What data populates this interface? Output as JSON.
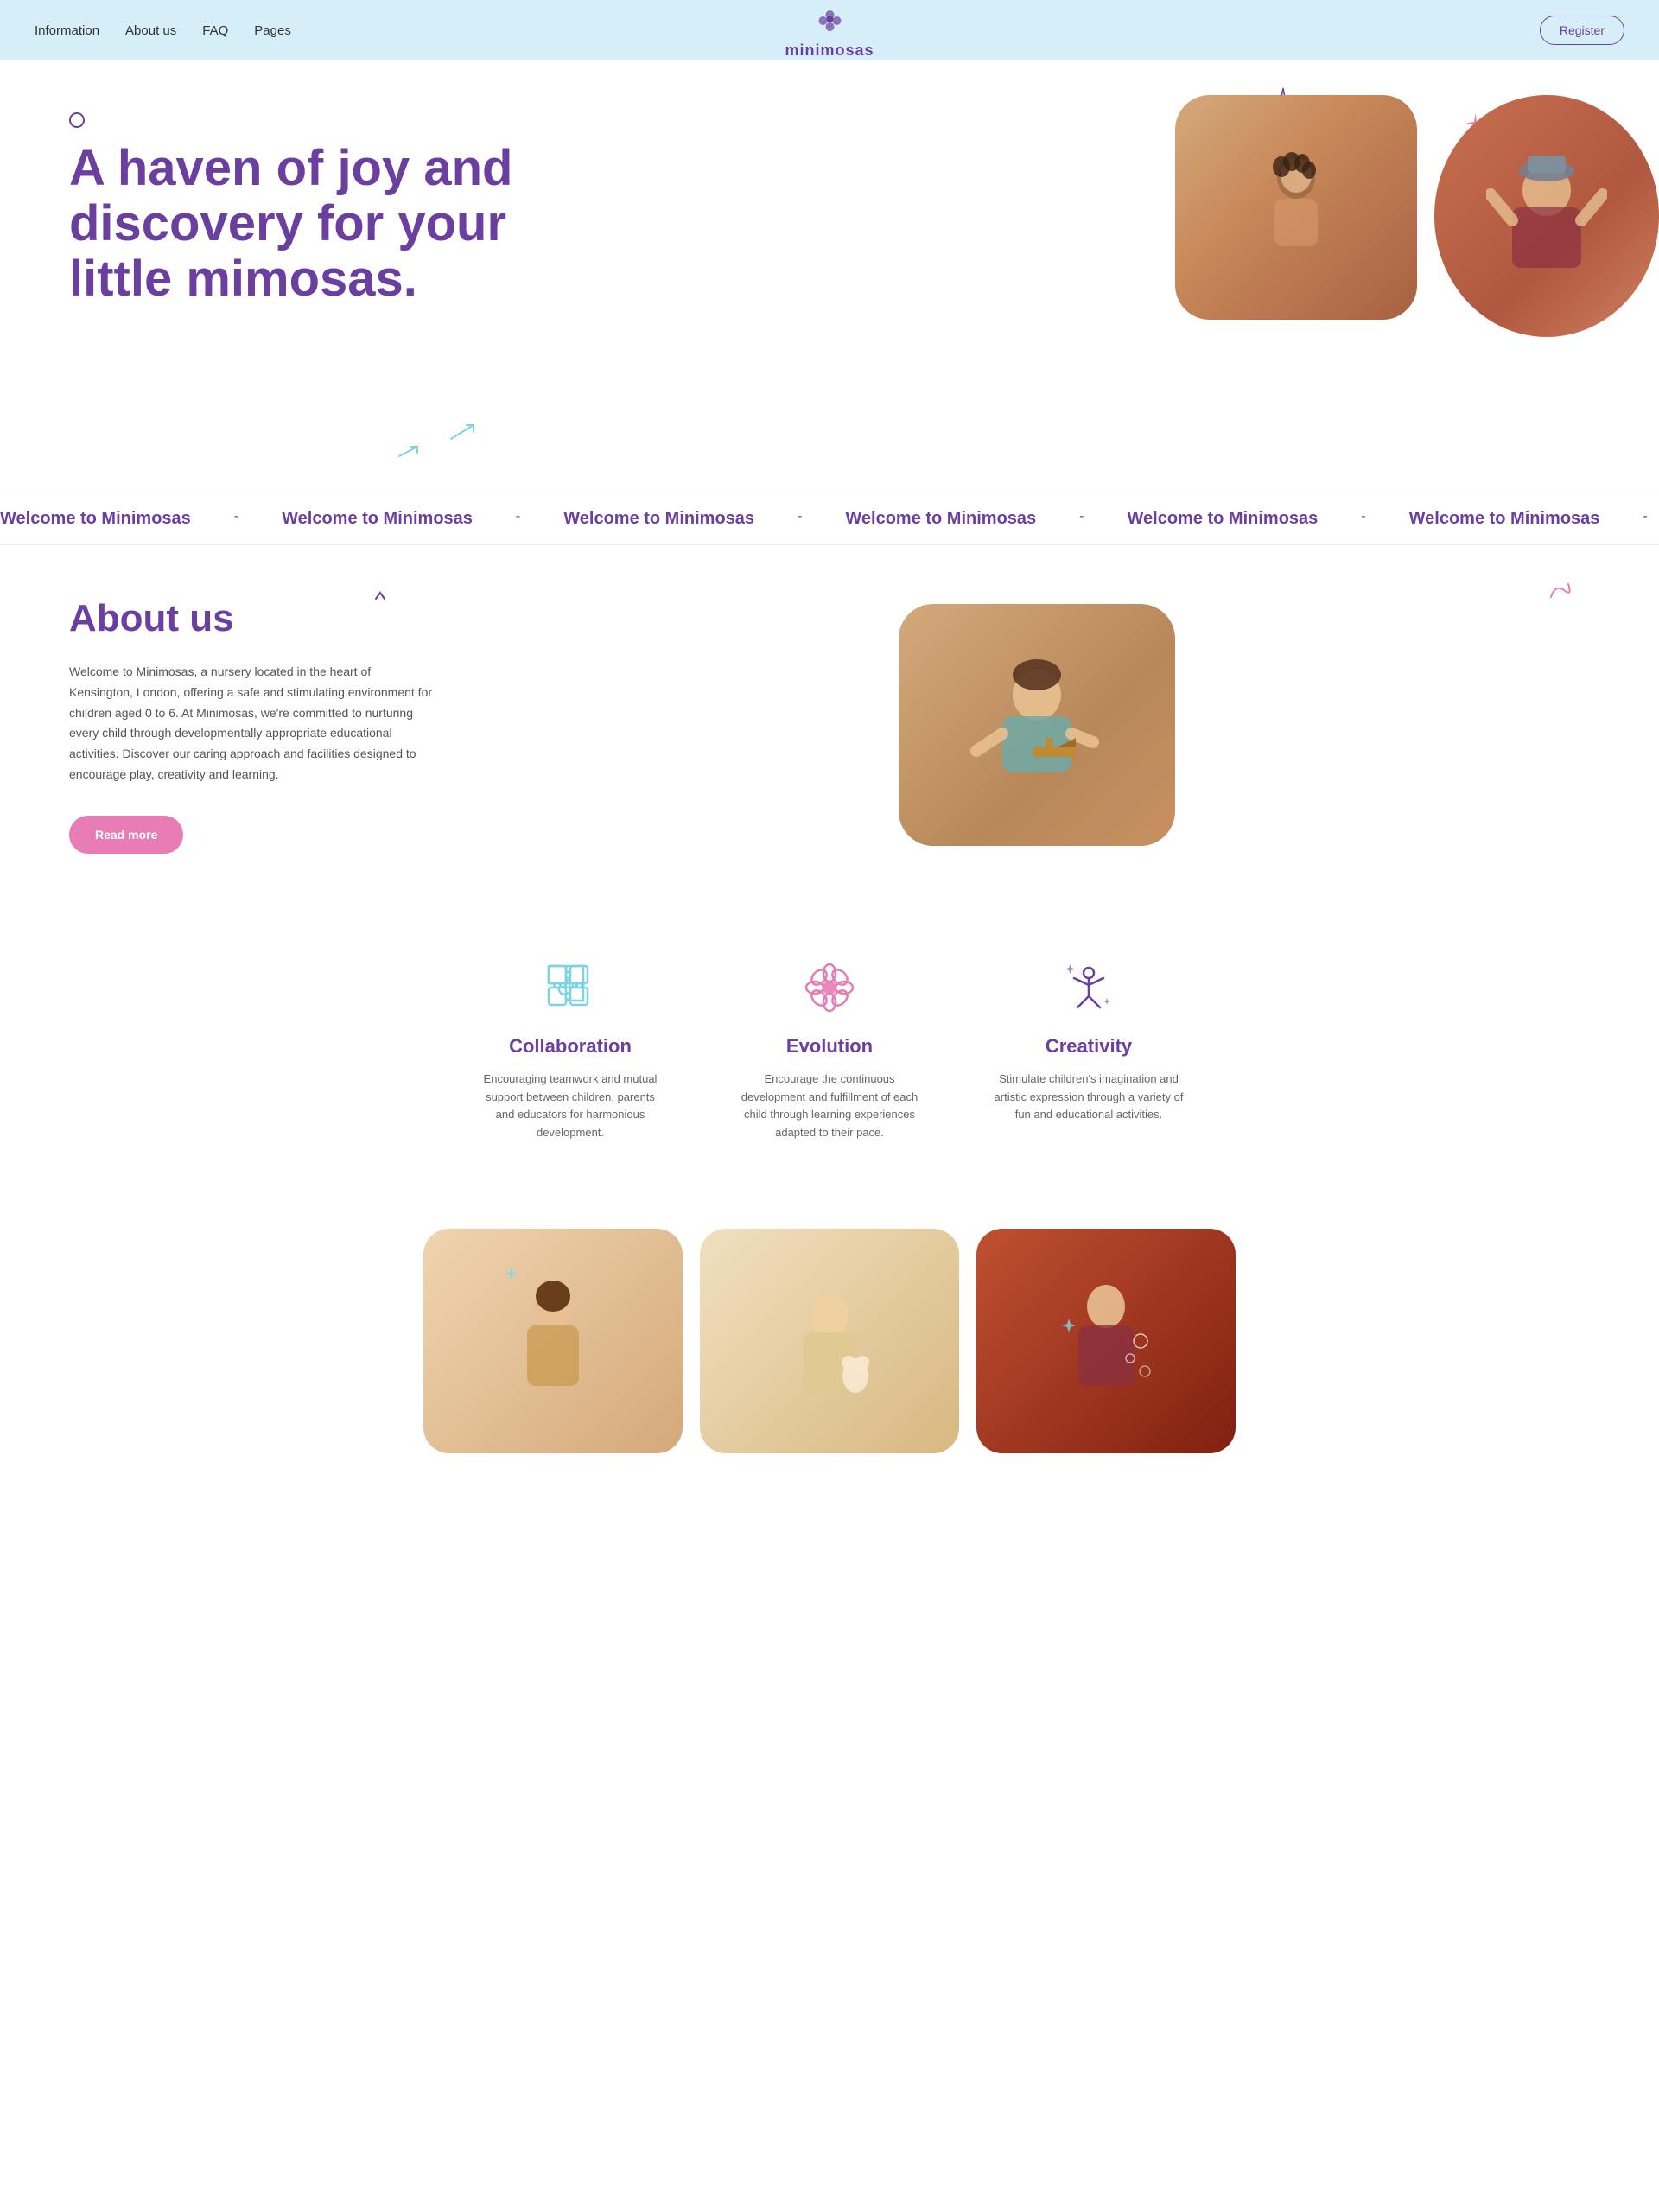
{
  "navbar": {
    "links": [
      {
        "label": "Information",
        "href": "#"
      },
      {
        "label": "About us",
        "href": "#"
      },
      {
        "label": "FAQ",
        "href": "#"
      },
      {
        "label": "Pages",
        "href": "#"
      }
    ],
    "logo": {
      "text": "minimosas",
      "icon": "🌸"
    },
    "register_label": "Register"
  },
  "hero": {
    "title": "A haven of joy and discovery for your little mimosas.",
    "circle_decor": true
  },
  "marquee": {
    "items": [
      "Welcome to Minimosas",
      "Welcome to Minimosas",
      "Welcome to Minimosas",
      "Welcome to Minimosas",
      "Welcome to Minimosas",
      "Welcome to Minimosas",
      "Welcome to Minimosas",
      "Welcome to Minimosas"
    ]
  },
  "about": {
    "title": "About us",
    "description": "Welcome to Minimosas, a nursery located in the heart of Kensington, London, offering a safe and stimulating environment for children aged 0 to 6. At Minimosas, we're committed to nurturing every child through developmentally appropriate educational activities. Discover our caring approach and facilities designed to encourage play, creativity and learning.",
    "read_more_label": "Read more"
  },
  "values": [
    {
      "title": "Collaboration",
      "description": "Encouraging teamwork and mutual support between children, parents and educators for harmonious development.",
      "icon_type": "puzzle"
    },
    {
      "title": "Evolution",
      "description": "Encourage the continuous development and fulfillment of each child through learning experiences adapted to their pace.",
      "icon_type": "flower"
    },
    {
      "title": "Creativity",
      "description": "Stimulate children's imagination and artistic expression through a variety of fun and educational activities.",
      "icon_type": "star-person"
    }
  ],
  "gallery": {
    "items": [
      "child1",
      "child2",
      "child3"
    ]
  },
  "colors": {
    "purple": "#6b3fa0",
    "pink": "#e87db5",
    "light_blue": "#d6eef8",
    "teal": "#7dd4e0"
  }
}
